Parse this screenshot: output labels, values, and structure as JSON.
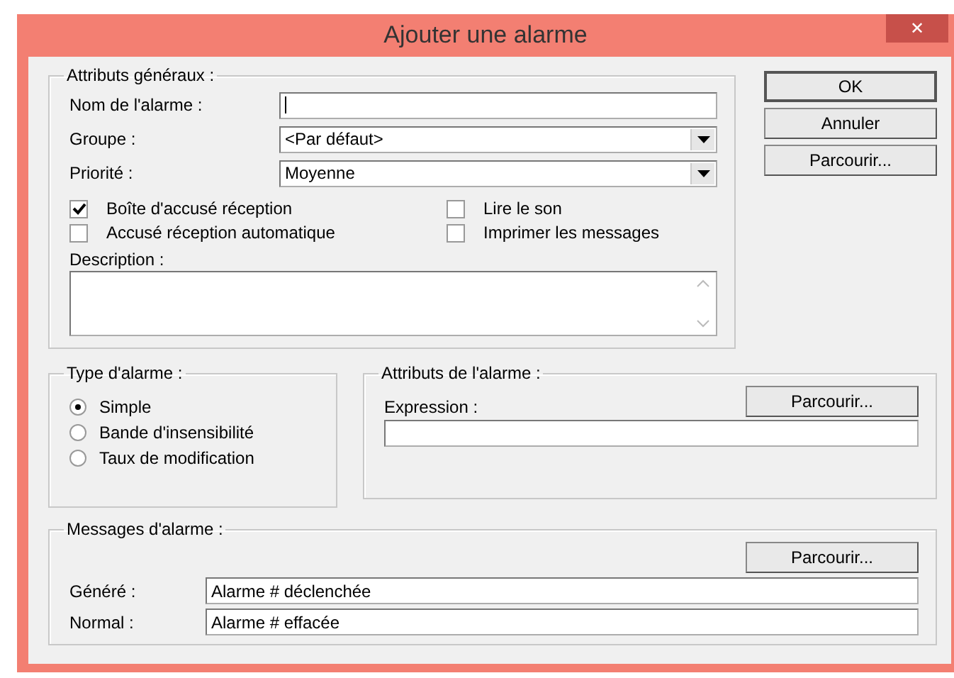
{
  "window": {
    "title": "Ajouter une alarme",
    "close": "✕"
  },
  "general": {
    "legend": "Attributs généraux :",
    "name": {
      "label": "Nom de l'alarme :"
    },
    "group": {
      "label": "Groupe :",
      "value": "<Par défaut>"
    },
    "priority": {
      "label": "Priorité :",
      "value": "Moyenne"
    },
    "checkboxes": [
      {
        "label": "Boîte d'accusé réception",
        "checked": true
      },
      {
        "label": "Lire le son",
        "checked": false
      },
      {
        "label": "Accusé réception automatique",
        "checked": false
      },
      {
        "label": "Imprimer les messages",
        "checked": false
      }
    ],
    "description": {
      "label": "Description :"
    }
  },
  "buttons": [
    "OK",
    "Annuler",
    "Parcourir..."
  ],
  "alarm_type": {
    "legend": "Type d'alarme :",
    "options": [
      {
        "label": "Simple",
        "selected": true
      },
      {
        "label": "Bande d'insensibilité",
        "selected": false
      },
      {
        "label": "Taux de modification",
        "selected": false
      }
    ]
  },
  "alarm_attributes": {
    "legend": "Attributs de l'alarme :",
    "browse": "Parcourir...",
    "expression": {
      "label": "Expression :"
    }
  },
  "messages": {
    "legend": "Messages d'alarme :",
    "browse": "Parcourir...",
    "fields": [
      {
        "label": "Généré :",
        "value": "Alarme # déclenchée"
      },
      {
        "label": "Normal :",
        "value": "Alarme # effacée"
      }
    ]
  }
}
